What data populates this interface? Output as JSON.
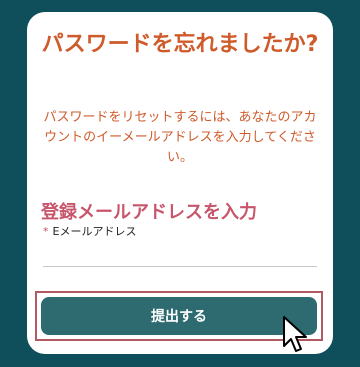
{
  "card": {
    "title": "パスワードを忘れましたか?",
    "description": "パスワードをリセットするには、あなたのアカウントのイーメールアドレスを入力してください。",
    "section_heading": "登録メールアドレスを入力",
    "email_field": {
      "required_mark": "*",
      "label": "Eメールアドレス",
      "value": "",
      "placeholder": ""
    },
    "submit_label": "提出する"
  },
  "colors": {
    "background": "#0f4f5b",
    "title": "#cf5b2b",
    "heading": "#c7556b",
    "button": "#2d6b70",
    "focus_ring": "#b25a63"
  },
  "icons": {
    "cursor": "mouse-pointer-icon"
  }
}
